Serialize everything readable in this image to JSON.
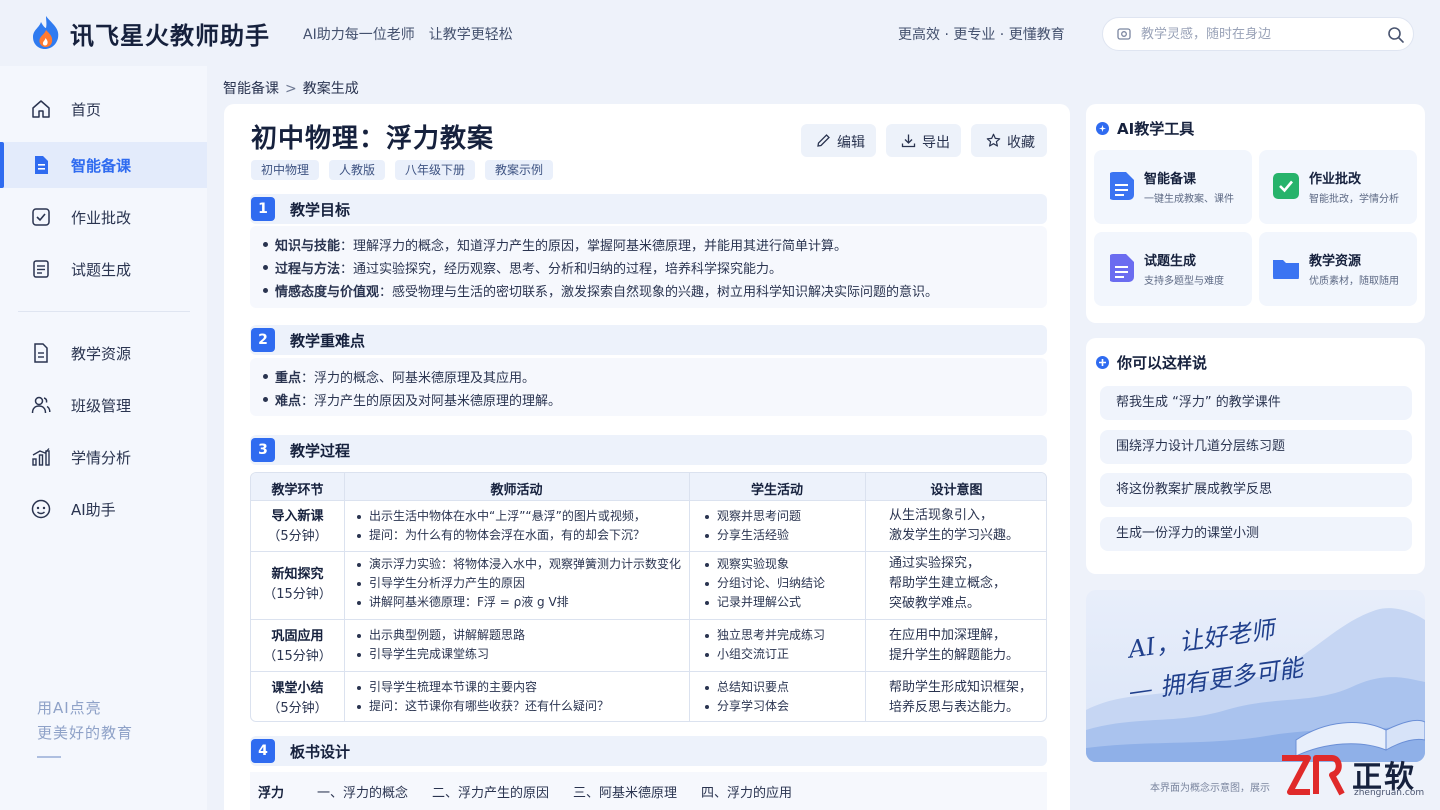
{
  "header": {
    "app_title": "讯飞星火教师助手",
    "slogan_1": "AI助力每一位老师",
    "slogan_2": "让教学更轻松",
    "right_text": "更高效 · 更专业 · 更懂教育",
    "search_placeholder": "教学灵感，随时在身边"
  },
  "sidebar": {
    "items": [
      {
        "label": "首页",
        "icon": "home-icon"
      },
      {
        "label": "智能备课",
        "icon": "document-icon"
      },
      {
        "label": "作业批改",
        "icon": "checkbox-icon"
      },
      {
        "label": "试题生成",
        "icon": "list-icon"
      },
      {
        "label": "教学资源",
        "icon": "resource-icon"
      },
      {
        "label": "班级管理",
        "icon": "users-icon"
      },
      {
        "label": "学情分析",
        "icon": "bar-chart-icon"
      },
      {
        "label": "AI助手",
        "icon": "robot-icon"
      }
    ],
    "active_index": 1,
    "slogan_1": "用AI点亮",
    "slogan_2": "更美好的教育"
  },
  "breadcrumb": {
    "parent": "智能备课",
    "separator": ">",
    "current": "教案生成"
  },
  "doc": {
    "title": "初中物理：浮力教案",
    "tags": [
      "初中物理",
      "人教版",
      "八年级下册",
      "教案示例"
    ],
    "actions": {
      "edit": "编辑",
      "export": "导出",
      "favorite": "收藏"
    },
    "sections": [
      {
        "num": "1",
        "title": "教学目标"
      },
      {
        "num": "2",
        "title": "教学重难点"
      },
      {
        "num": "3",
        "title": "教学过程"
      },
      {
        "num": "4",
        "title": "板书设计"
      }
    ],
    "goals": [
      {
        "key": "知识与技能",
        "text": "：理解浮力的概念，知道浮力产生的原因，掌握阿基米德原理，并能用其进行简单计算。"
      },
      {
        "key": "过程与方法",
        "text": "：通过实验探究，经历观察、思考、分析和归纳的过程，培养科学探究能力。"
      },
      {
        "key": "情感态度与价值观",
        "text": "：感受物理与生活的密切联系，激发探索自然现象的兴趣，树立用科学知识解决实际问题的意识。"
      }
    ],
    "key_points": [
      {
        "key": "重点",
        "text": "：浮力的概念、阿基米德原理及其应用。"
      },
      {
        "key": "难点",
        "text": "：浮力产生的原因及对阿基米德原理的理解。"
      }
    ],
    "process": {
      "headers": [
        "教学环节",
        "教师活动",
        "学生活动",
        "设计意图"
      ],
      "rows": [
        {
          "stage": "导入新课",
          "time": "（5分钟）",
          "teacher": [
            "出示生活中物体在水中“上浮”“悬浮”的图片或视频，",
            "提问：为什么有的物体会浮在水面，有的却会下沉？"
          ],
          "student": [
            "观察并思考问题",
            "分享生活经验"
          ],
          "intent": [
            "从生活现象引入，",
            "激发学生的学习兴趣。"
          ]
        },
        {
          "stage": "新知探究",
          "time": "（15分钟）",
          "teacher": [
            "演示浮力实验：将物体浸入水中，观察弹簧测力计示数变化",
            "引导学生分析浮力产生的原因",
            "讲解阿基米德原理：F浮 = ρ液 g V排"
          ],
          "student": [
            "观察实验现象",
            "分组讨论、归纳结论",
            "记录并理解公式"
          ],
          "intent": [
            "通过实验探究，",
            "帮助学生建立概念，",
            "突破教学难点。"
          ]
        },
        {
          "stage": "巩固应用",
          "time": "（15分钟）",
          "teacher": [
            "出示典型例题，讲解解题思路",
            "引导学生完成课堂练习"
          ],
          "student": [
            "独立思考并完成练习",
            "小组交流订正"
          ],
          "intent": [
            "在应用中加深理解，",
            "提升学生的解题能力。"
          ]
        },
        {
          "stage": "课堂小结",
          "time": "（5分钟）",
          "teacher": [
            "引导学生梳理本节课的主要内容",
            "提问：这节课你有哪些收获？还有什么疑问？"
          ],
          "student": [
            "总结知识要点",
            "分享学习体会"
          ],
          "intent": [
            "帮助学生形成知识框架，",
            "培养反思与表达能力。"
          ]
        }
      ]
    },
    "board": {
      "label": "浮力",
      "items": [
        "一、浮力的概念",
        "二、浮力产生的原因",
        "三、阿基米德原理",
        "四、浮力的应用"
      ]
    }
  },
  "tools_panel": {
    "title": "AI教学工具",
    "tools": [
      {
        "name": "智能备课",
        "desc": "一键生成教案、课件",
        "color": "#3b74f2"
      },
      {
        "name": "作业批改",
        "desc": "智能批改，学情分析",
        "color": "#27b36b"
      },
      {
        "name": "试题生成",
        "desc": "支持多题型与难度",
        "color": "#6b6cf0"
      },
      {
        "name": "教学资源",
        "desc": "优质素材，随取随用",
        "color": "#3b74f2"
      }
    ]
  },
  "suggest_panel": {
    "title": "你可以这样说",
    "items": [
      "帮我生成 “浮力” 的教学课件",
      "围绕浮力设计几道分层练习题",
      "将这份教案扩展成教学反思",
      "生成一份浮力的课堂小测"
    ]
  },
  "promo": {
    "line1": "AI，让好老师",
    "line2": "— 拥有更多可能"
  },
  "footnote": "本界面为概念示意图，展示",
  "watermark": {
    "text": "正软",
    "url": "zhengruan.com"
  },
  "colors": {
    "accent": "#2f6bf0",
    "background": "#eef2fa"
  }
}
